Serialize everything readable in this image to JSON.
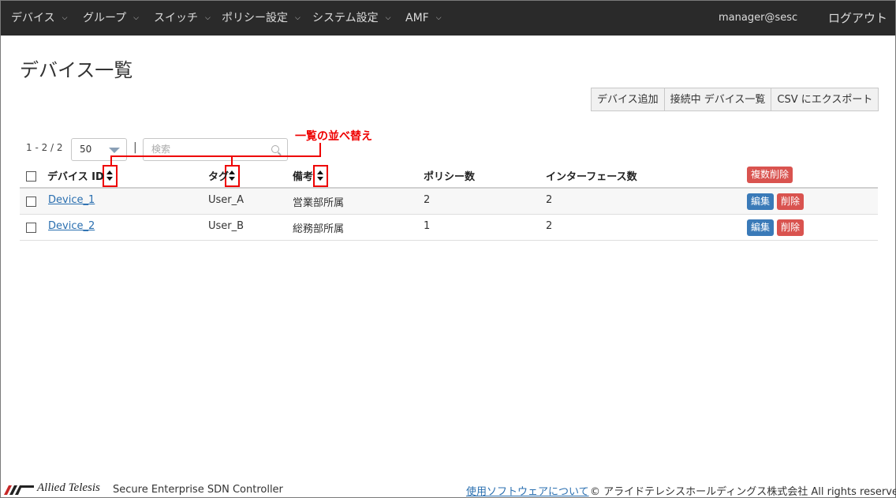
{
  "nav": {
    "items": [
      {
        "label": "デバイス"
      },
      {
        "label": "グループ"
      },
      {
        "label": "スイッチ"
      },
      {
        "label": "ポリシー設定"
      },
      {
        "label": "システム設定"
      },
      {
        "label": "AMF"
      }
    ],
    "user": "manager@sesc",
    "logout": "ログアウト"
  },
  "page": {
    "title": "デバイス一覧"
  },
  "toolbar": {
    "add_device": "デバイス追加",
    "connected_list": "接続中 デバイス一覧",
    "export_csv": "CSV にエクスポート"
  },
  "list_controls": {
    "range": "1 - 2 / 2",
    "page_size": "50",
    "separator": "|",
    "search_placeholder": "検索"
  },
  "annotation": {
    "label": "一覧の並べ替え",
    "color": "#e00000"
  },
  "table": {
    "headers": {
      "device_id": "デバイス ID",
      "tag": "タグ",
      "note": "備考",
      "policy_count": "ポリシー数",
      "interface_count": "インターフェース数",
      "bulk_delete": "複数削除"
    },
    "rows": [
      {
        "device_id": "Device_1",
        "tag": "User_A",
        "note": "営業部所属",
        "policy_count": "2",
        "interface_count": "2",
        "edit": "編集",
        "delete": "削除"
      },
      {
        "device_id": "Device_2",
        "tag": "User_B",
        "note": "総務部所属",
        "policy_count": "1",
        "interface_count": "2",
        "edit": "編集",
        "delete": "削除"
      }
    ]
  },
  "footer": {
    "brand": "Allied Telesis",
    "product": "Secure Enterprise SDN Controller",
    "about_link": "使用ソフトウェアについて",
    "copyright": "© アライドテレシスホールディングス株式会社 All rights reserved."
  },
  "colors": {
    "navbar": "#2a2a2a",
    "primary": "#3a7ab8",
    "danger": "#d9534f",
    "link": "#2a6fb0"
  }
}
